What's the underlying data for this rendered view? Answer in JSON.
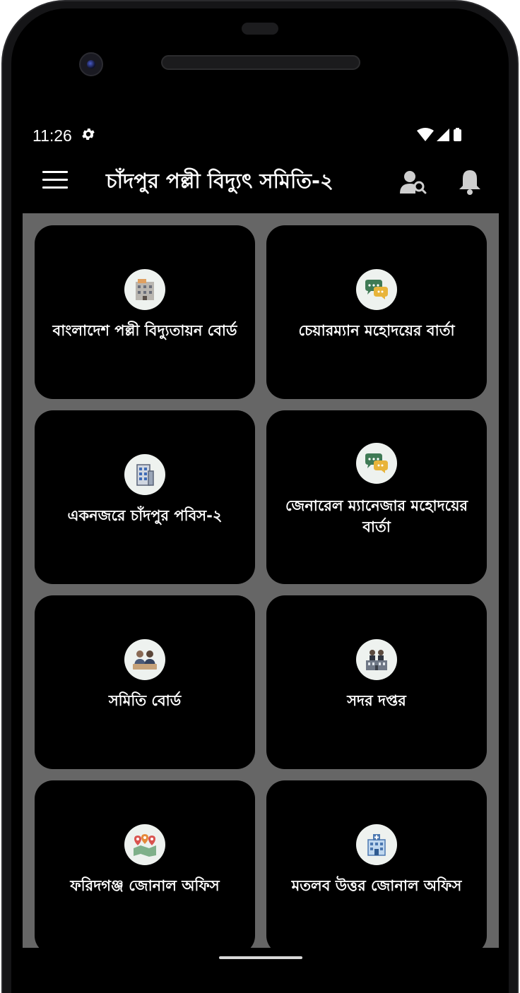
{
  "status_bar": {
    "time": "11:26",
    "icons": [
      "settings-gear-icon",
      "wifi-icon",
      "signal-icon",
      "battery-icon"
    ]
  },
  "app_bar": {
    "title": "চাঁদপুর পল্লী বিদ্যুৎ সমিতি-২",
    "menu_icon": "hamburger-menu-icon",
    "actions": [
      "user-search-icon",
      "notification-bell-icon"
    ]
  },
  "theme": {
    "background": "#000000",
    "grid_background": "#666666",
    "card_background": "#000000",
    "text": "#ffffff",
    "icon_circle": "#eef2ef"
  },
  "cards": [
    {
      "label": "বাংলাদেশ পল্লী বিদ্যুতায়ন বোর্ড",
      "icon": "office-building-icon"
    },
    {
      "label": "চেয়ারম্যান মহোদয়ের বার্তা",
      "icon": "chat-bubbles-icon"
    },
    {
      "label": "একনজরে চাঁদপুর পবিস-২",
      "icon": "tower-building-icon"
    },
    {
      "label": "জেনারেল ম্যানেজার মহোদয়ের বার্তা",
      "icon": "chat-bubbles-icon"
    },
    {
      "label": "সমিতি বোর্ড",
      "icon": "board-meeting-icon"
    },
    {
      "label": "সদর দপ্তর",
      "icon": "headquarters-icon"
    },
    {
      "label": "ফরিদগঞ্জ জোনাল অফিস",
      "icon": "zonal-map-pins-icon"
    },
    {
      "label": "মতলব উত্তর জোনাল অফিস",
      "icon": "hospital-building-icon"
    }
  ]
}
